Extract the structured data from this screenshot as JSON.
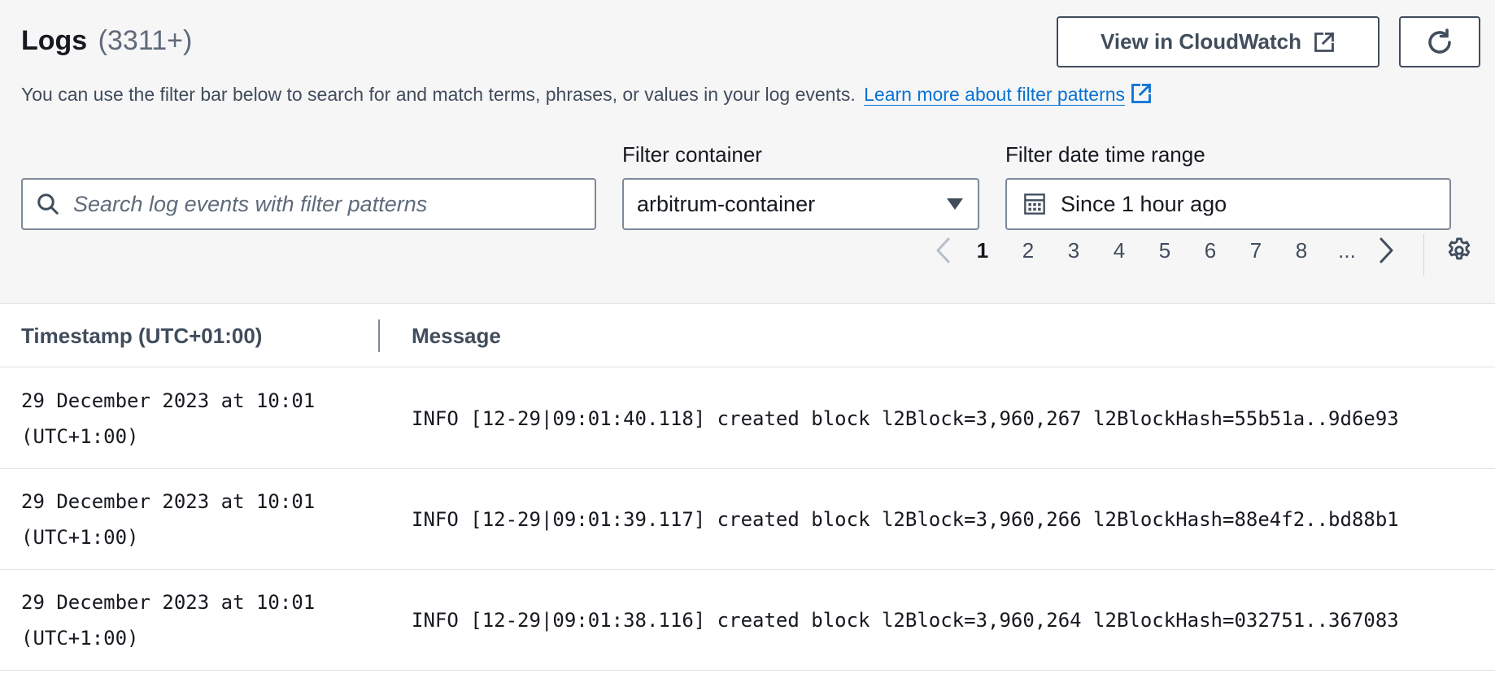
{
  "header": {
    "title": "Logs",
    "count": "(3311+)",
    "view_cloudwatch_label": "View in CloudWatch"
  },
  "description": {
    "text": "You can use the filter bar below to search for and match terms, phrases, or values in your log events.",
    "link_text": "Learn more about filter patterns"
  },
  "filters": {
    "search_placeholder": "Search log events with filter patterns",
    "container_label": "Filter container",
    "container_value": "arbitrum-container",
    "daterange_label": "Filter date time range",
    "daterange_value": "Since 1 hour ago"
  },
  "pagination": {
    "pages": [
      "1",
      "2",
      "3",
      "4",
      "5",
      "6",
      "7",
      "8",
      "..."
    ],
    "current": "1"
  },
  "table": {
    "columns": [
      "Timestamp (UTC+01:00)",
      "Message"
    ],
    "rows": [
      {
        "timestamp_line1": "29 December 2023 at 10:01",
        "timestamp_line2": "(UTC+1:00)",
        "message": "INFO [12-29|09:01:40.118] created block l2Block=3,960,267 l2BlockHash=55b51a..9d6e93"
      },
      {
        "timestamp_line1": "29 December 2023 at 10:01",
        "timestamp_line2": "(UTC+1:00)",
        "message": "INFO [12-29|09:01:39.117] created block l2Block=3,960,266 l2BlockHash=88e4f2..bd88b1"
      },
      {
        "timestamp_line1": "29 December 2023 at 10:01",
        "timestamp_line2": "(UTC+1:00)",
        "message": "INFO [12-29|09:01:38.116] created block l2Block=3,960,264 l2BlockHash=032751..367083"
      }
    ]
  },
  "colors": {
    "link": "#0972d3",
    "text": "#16191f",
    "secondary_text": "#5f6b7a",
    "button_border": "#414d5c",
    "panel_bg": "#f6f6f7"
  },
  "icons": {
    "external_link": "external-link-icon",
    "refresh": "refresh-icon",
    "search": "search-icon",
    "dropdown": "caret-down-icon",
    "calendar": "calendar-icon",
    "prev": "chevron-left-icon",
    "next": "chevron-right-icon",
    "settings": "gear-icon"
  }
}
